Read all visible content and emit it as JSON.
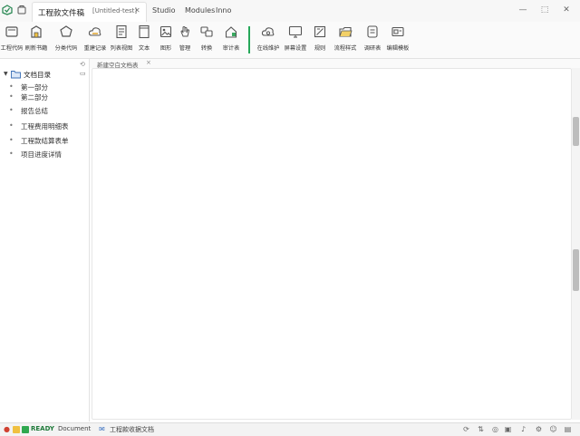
{
  "window": {
    "tab_title": "工程款文件稿",
    "tab_subtitle": "[Untitled-test]",
    "menus": [
      "Studio",
      "Modules",
      "Inno"
    ]
  },
  "toolbar": {
    "items": [
      {
        "label": "工程代码",
        "icon": "frame-icon"
      },
      {
        "label": "刷新书籍",
        "icon": "building-icon"
      },
      {
        "label": "分类代码",
        "icon": "pentagon-icon"
      },
      {
        "label": "重建记录",
        "icon": "cloud-edit-icon"
      },
      {
        "label": "列表视图",
        "icon": "list-page-icon"
      },
      {
        "label": "文本",
        "icon": "blank-page-icon"
      },
      {
        "label": "图形",
        "icon": "image-icon"
      },
      {
        "label": "管理",
        "icon": "hand-icon"
      },
      {
        "label": "转换",
        "icon": "swap-icon"
      },
      {
        "label": "审计表",
        "icon": "house-icon"
      },
      {
        "label": "在线维护",
        "icon": "cloud-gear-icon"
      },
      {
        "label": "屏幕设置",
        "icon": "monitor-icon"
      },
      {
        "label": "规则",
        "icon": "grid-icon"
      },
      {
        "label": "流程样式",
        "icon": "folder-icon"
      },
      {
        "label": "调研表",
        "icon": "document-icon"
      },
      {
        "label": "编辑模板",
        "icon": "template-icon"
      }
    ]
  },
  "sidebar": {
    "root_label": "文档目录",
    "items": [
      "第一部分",
      "第二部分",
      "报告总结",
      "工程费用明细表",
      "工程款结算表单",
      "项目进度详情"
    ]
  },
  "main": {
    "tab_label": "新建空白文档表",
    "scroll_thumbs": [
      0.0,
      0.62
    ]
  },
  "statusbar": {
    "mode": "READY",
    "doc_status": "Document",
    "project": "工程款收据文档"
  }
}
